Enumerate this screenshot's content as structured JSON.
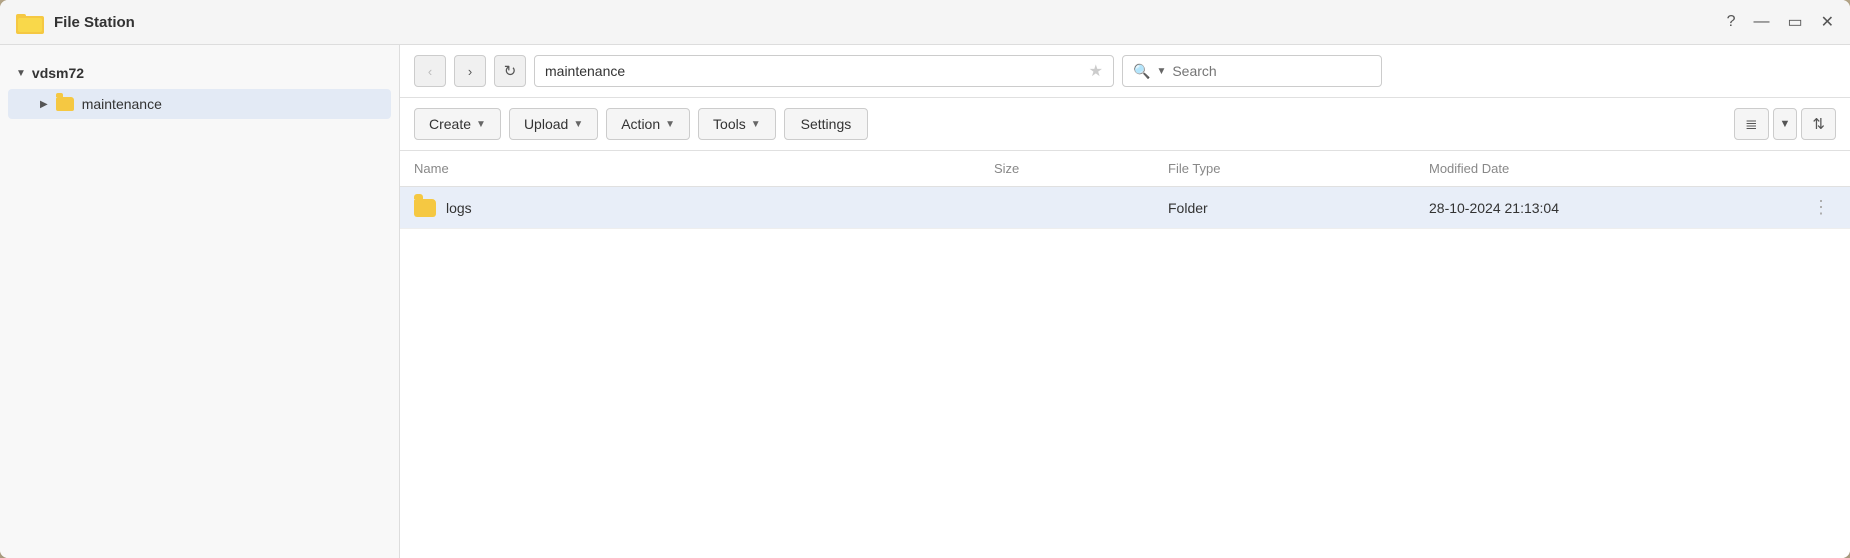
{
  "window": {
    "title": "File Station",
    "controls": {
      "help": "?",
      "minimize": "—",
      "maximize": "▭",
      "close": "✕"
    }
  },
  "sidebar": {
    "server_label": "vdsm72",
    "items": [
      {
        "label": "maintenance",
        "selected": true
      }
    ]
  },
  "toolbar": {
    "path": "maintenance",
    "search_placeholder": "Search"
  },
  "actions": {
    "create_label": "Create",
    "upload_label": "Upload",
    "action_label": "Action",
    "tools_label": "Tools",
    "settings_label": "Settings"
  },
  "table": {
    "columns": {
      "name": "Name",
      "size": "Size",
      "type": "File Type",
      "date": "Modified Date"
    },
    "rows": [
      {
        "name": "logs",
        "icon": "folder",
        "size": "",
        "type": "Folder",
        "date": "28-10-2024 21:13:04"
      }
    ]
  }
}
